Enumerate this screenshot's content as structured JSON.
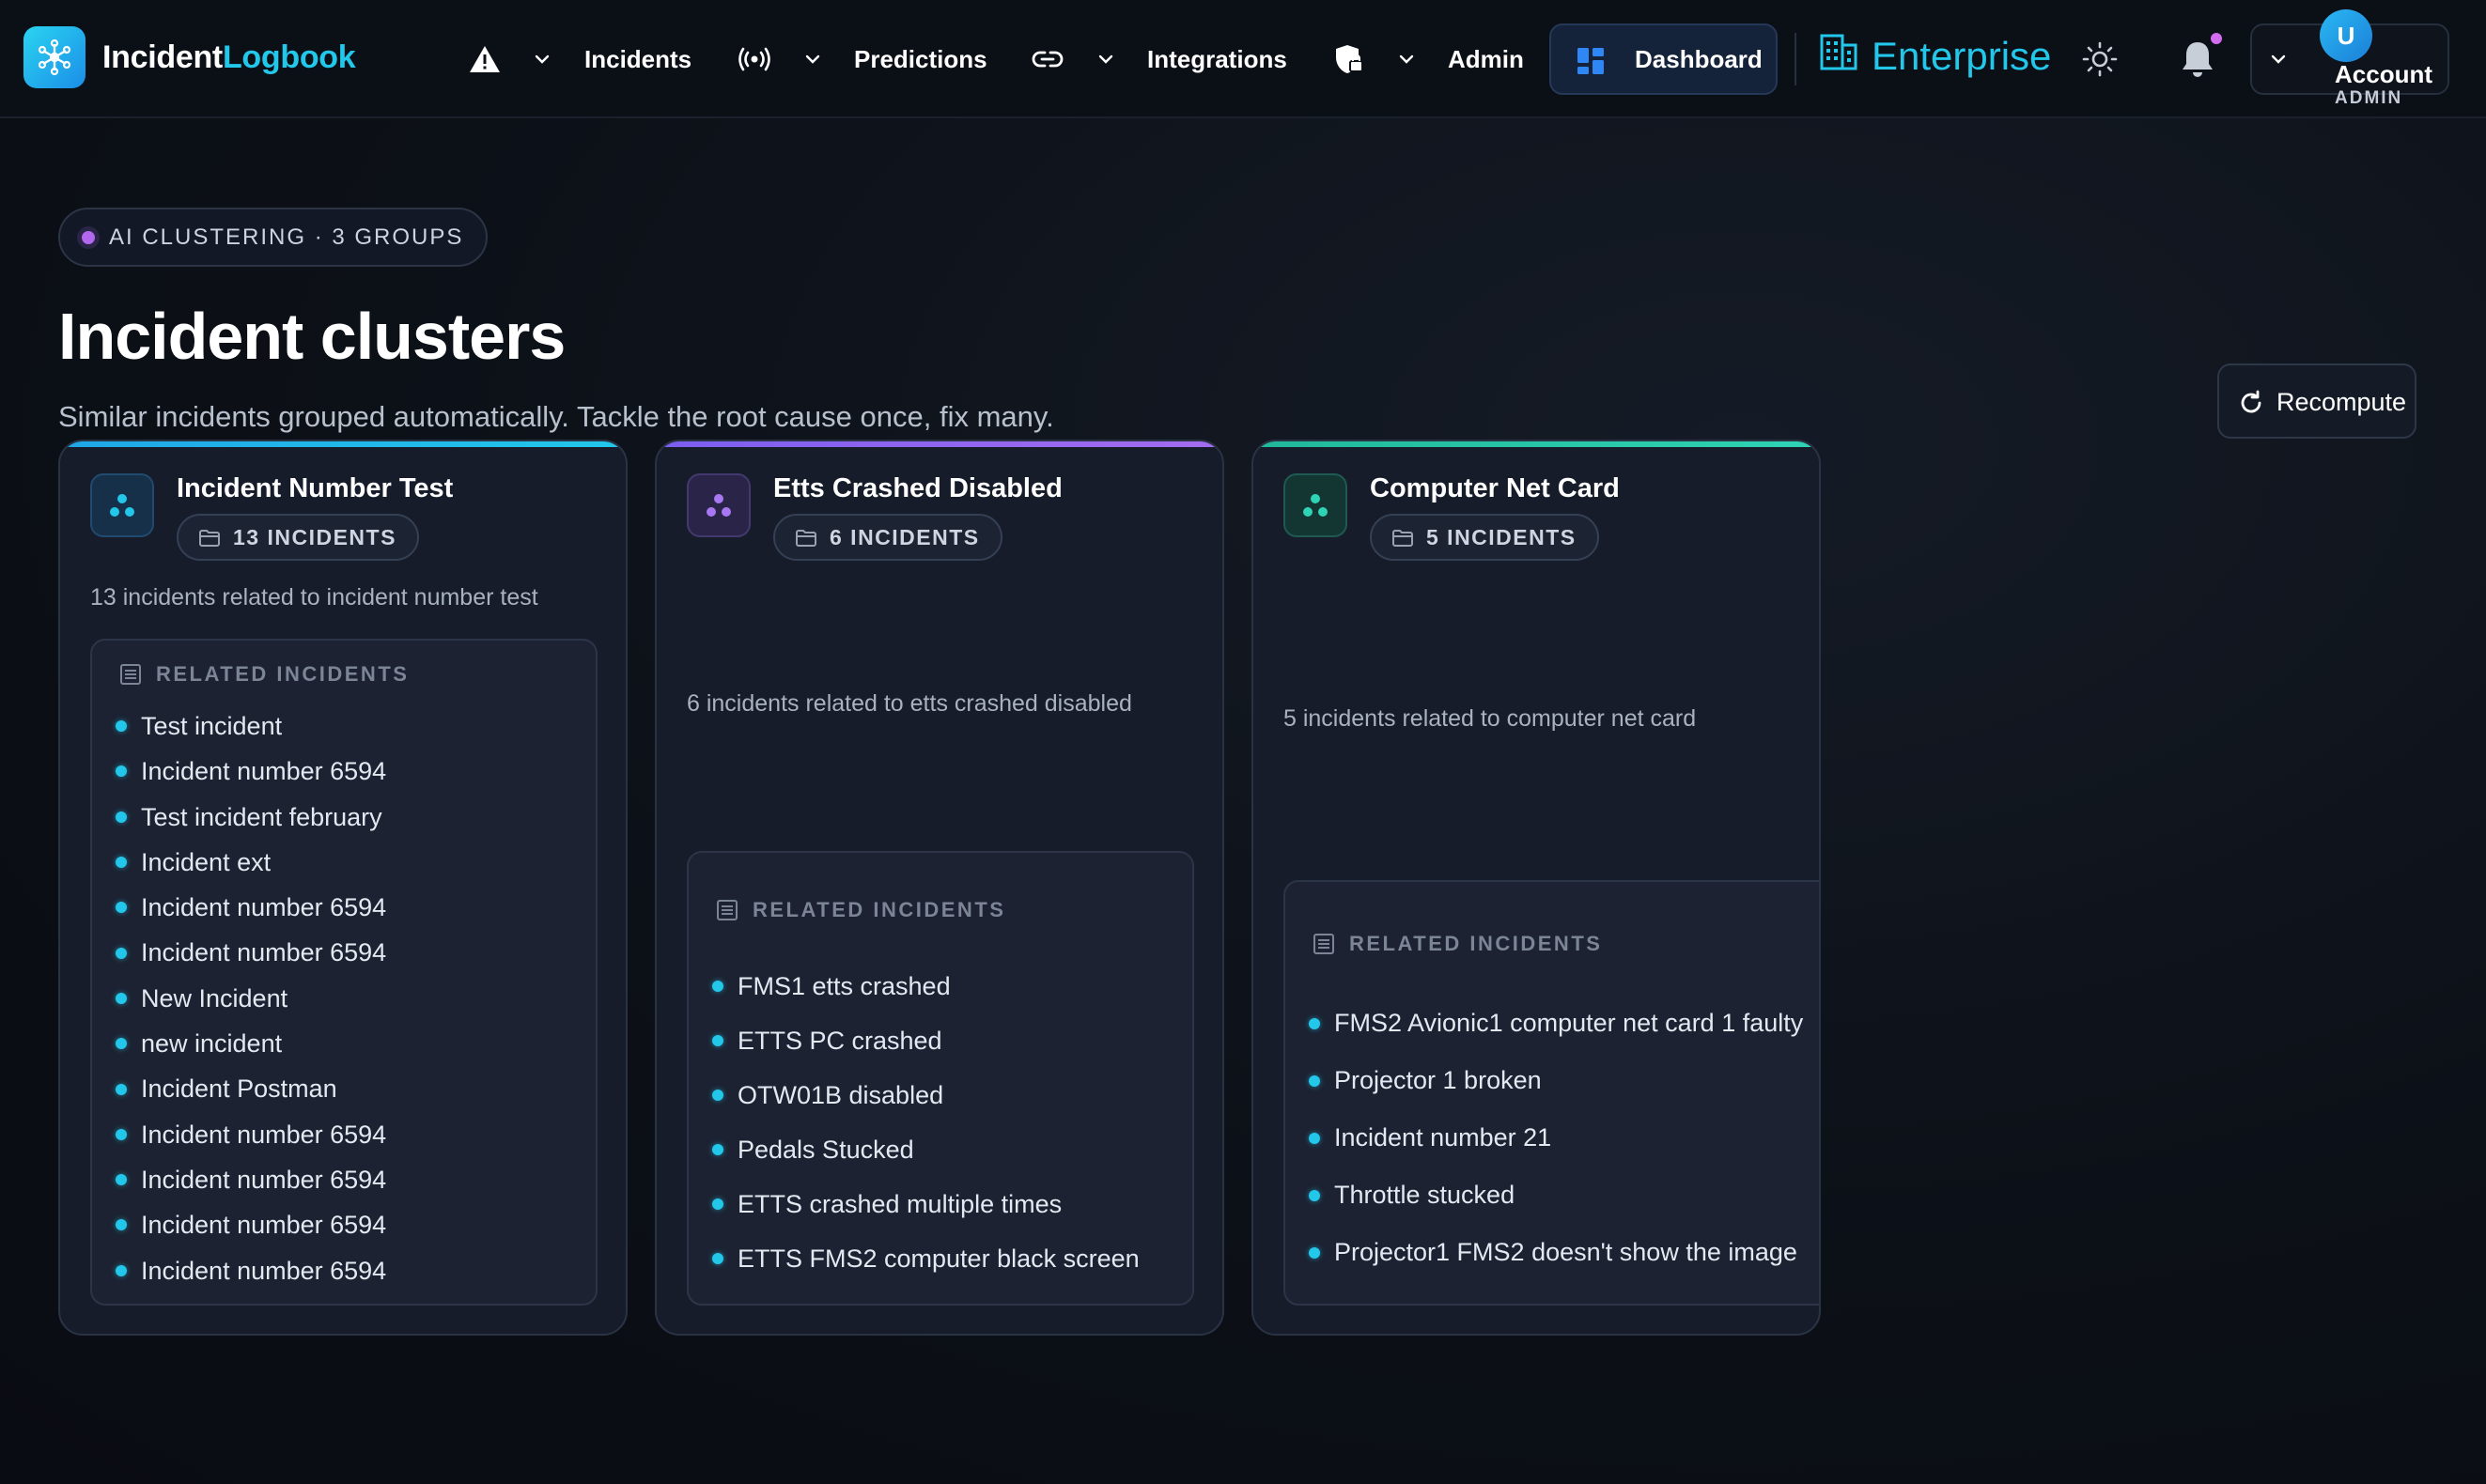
{
  "app": {
    "name_part1": "Incident",
    "name_part2": "Logbook"
  },
  "nav": {
    "items": [
      {
        "label": "Incidents",
        "icon": "warning-triangle-icon"
      },
      {
        "label": "Predictions",
        "icon": "broadcast-icon"
      },
      {
        "label": "Integrations",
        "icon": "link-icon"
      },
      {
        "label": "Admin",
        "icon": "shield-lock-icon"
      }
    ],
    "dashboard_label": "Dashboard",
    "plan_label": "Enterprise",
    "account": {
      "initial": "U",
      "name": "Account",
      "role": "ADMIN"
    }
  },
  "header": {
    "pill": "AI CLUSTERING · 3 GROUPS",
    "title": "Incident clusters",
    "subtitle": "Similar incidents grouped automatically. Tackle the root cause once, fix many.",
    "recompute_label": "Recompute"
  },
  "colors": {
    "accent_cyan": "#22c7ea",
    "accent_purple": "#9b6cf0",
    "accent_teal": "#2fd3b5",
    "background": "#0c1017"
  },
  "related_heading": "RELATED INCIDENTS",
  "clusters": [
    {
      "name": "Incident Number Test",
      "count": "13 INCIDENTS",
      "description": "13 incidents related to incident number test",
      "incidents": [
        "Test incident",
        "Incident number 6594",
        "Test incident february",
        "Incident ext",
        "Incident number 6594",
        "Incident number 6594",
        "New Incident",
        "new incident",
        "Incident Postman",
        "Incident number 6594",
        "Incident number 6594",
        "Incident number 6594",
        "Incident number 6594"
      ]
    },
    {
      "name": "Etts Crashed Disabled",
      "count": "6 INCIDENTS",
      "description": "6 incidents related to etts crashed disabled",
      "incidents": [
        "FMS1 etts crashed",
        "ETTS PC crashed",
        "OTW01B disabled",
        "Pedals Stucked",
        "ETTS crashed multiple times",
        "ETTS FMS2 computer black screen"
      ]
    },
    {
      "name": "Computer Net Card",
      "count": "5 INCIDENTS",
      "description": "5 incidents related to computer net card",
      "incidents": [
        "FMS2 Avionic1 computer net card 1 faulty",
        "Projector 1 broken",
        "Incident number 21",
        "Throttle stucked",
        "Projector1 FMS2 doesn't show the image"
      ]
    }
  ]
}
